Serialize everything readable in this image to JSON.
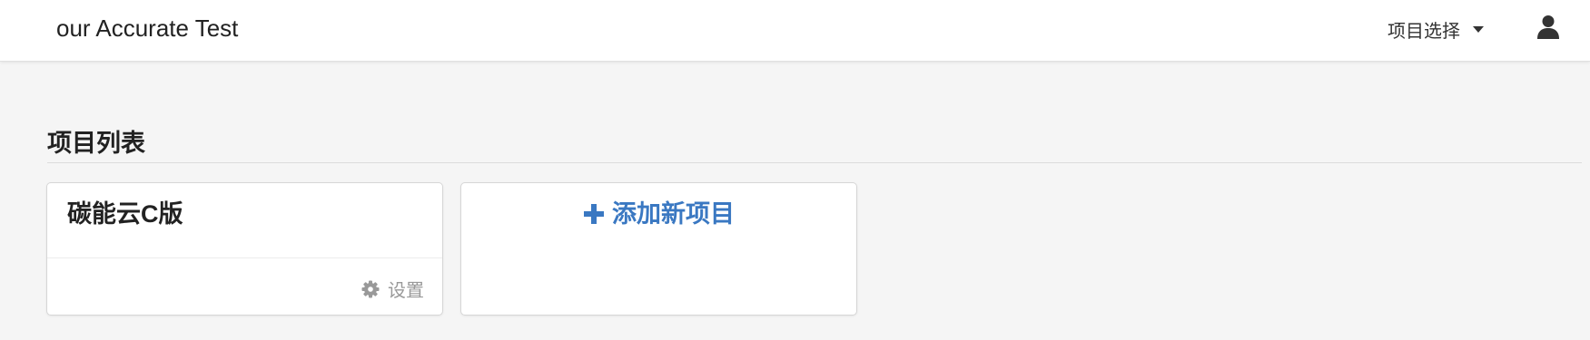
{
  "navbar": {
    "brand": "our Accurate Test",
    "project_select_label": "项目选择",
    "icons": {
      "dropdown": "caret-down-icon",
      "user": "user-icon"
    }
  },
  "main": {
    "section_title": "项目列表",
    "projects": [
      {
        "name": "碳能云C版",
        "settings_label": "设置",
        "settings_icon": "gear-icon"
      }
    ],
    "add_project_label": "添加新项目",
    "add_icon": "plus-icon"
  },
  "colors": {
    "accent": "#3a78c2",
    "background": "#f5f5f5",
    "muted": "#999999"
  }
}
